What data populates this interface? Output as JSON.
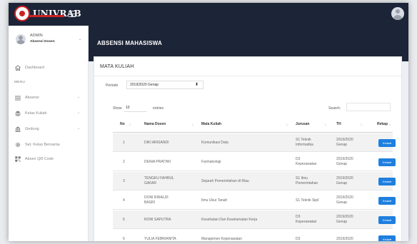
{
  "brand": {
    "name": "UNIVRAB"
  },
  "user": {
    "name": "ADMIN",
    "role": "Absensi Dosen"
  },
  "nav": {
    "dashboard": "Dashboard",
    "menu_heading": "MENU",
    "items": [
      {
        "label": "Absensi",
        "icon": "list-icon",
        "caret": "⌄"
      },
      {
        "label": "Kelas Kuliah",
        "icon": "layers-icon",
        "caret": "⌄"
      },
      {
        "label": "Gedung",
        "icon": "building-icon",
        "caret": "⌄"
      },
      {
        "label": "Set. Kelas Bersama",
        "icon": "gear-icon"
      },
      {
        "label": "Absen QR Code",
        "icon": "qr-code-icon"
      }
    ]
  },
  "page": {
    "title": "ABSENSI MAHASISWA"
  },
  "card": {
    "title": "MATA KULIAH",
    "period_label": "Periode",
    "period_value": "2019/2020 Genap",
    "show_label": "Show",
    "show_value": "10",
    "entries_label": "entries",
    "search_label": "Search:"
  },
  "table": {
    "columns": [
      "No",
      "Nama Dosen",
      "Mata Kuliah",
      "Jurusan",
      "TH",
      "Rekap"
    ],
    "action_label": "Kelas",
    "rows": [
      {
        "no": "1",
        "dosen": [
          "DIKI ARISANDI"
        ],
        "matkul": [
          "Komunikasi Data"
        ],
        "jurusan": [
          "S1 Teknik",
          "Informatika"
        ],
        "th": [
          "2019/2020",
          "Genap"
        ]
      },
      {
        "no": "2",
        "dosen": [
          "DENIA PRATIWI"
        ],
        "matkul": [
          "Farmakologi"
        ],
        "jurusan": [
          "D3",
          "Keperawatan"
        ],
        "th": [
          "2019/2020",
          "Genap"
        ]
      },
      {
        "no": "3",
        "dosen": [
          "TENGKU FAHRUL",
          "GAFAR"
        ],
        "matkul": [
          "Sejarah Pemerintahan di Riau"
        ],
        "jurusan": [
          "S1 Ilmu",
          "Pemerintahan"
        ],
        "th": [
          "2019/2020",
          "Genap"
        ]
      },
      {
        "no": "4",
        "dosen": [
          "DONI RINALDI",
          "BASRI"
        ],
        "matkul": [
          "Ilmu Ukur Tanah"
        ],
        "jurusan": [
          "S1 Teknik Sipil"
        ],
        "th": [
          "2019/2020",
          "Genap"
        ]
      },
      {
        "no": "5",
        "dosen": [
          "RONI SAPUTRA"
        ],
        "matkul": [
          "Kesehatan Dan Keselamatan Kerja"
        ],
        "jurusan": [
          "D3",
          "Keperawatan"
        ],
        "th": [
          "2019/2020",
          "Genap"
        ]
      },
      {
        "no": "6",
        "dosen": [
          "YULIA FEBRIANITA"
        ],
        "matkul": [
          "Manajemen Keperawatan"
        ],
        "jurusan": [
          "D3"
        ],
        "th": [
          "2019/2020"
        ]
      }
    ]
  },
  "colors": {
    "topbar": "#1c2437",
    "accent_button": "#1e7fdf",
    "logo_red": "#cc2222"
  }
}
